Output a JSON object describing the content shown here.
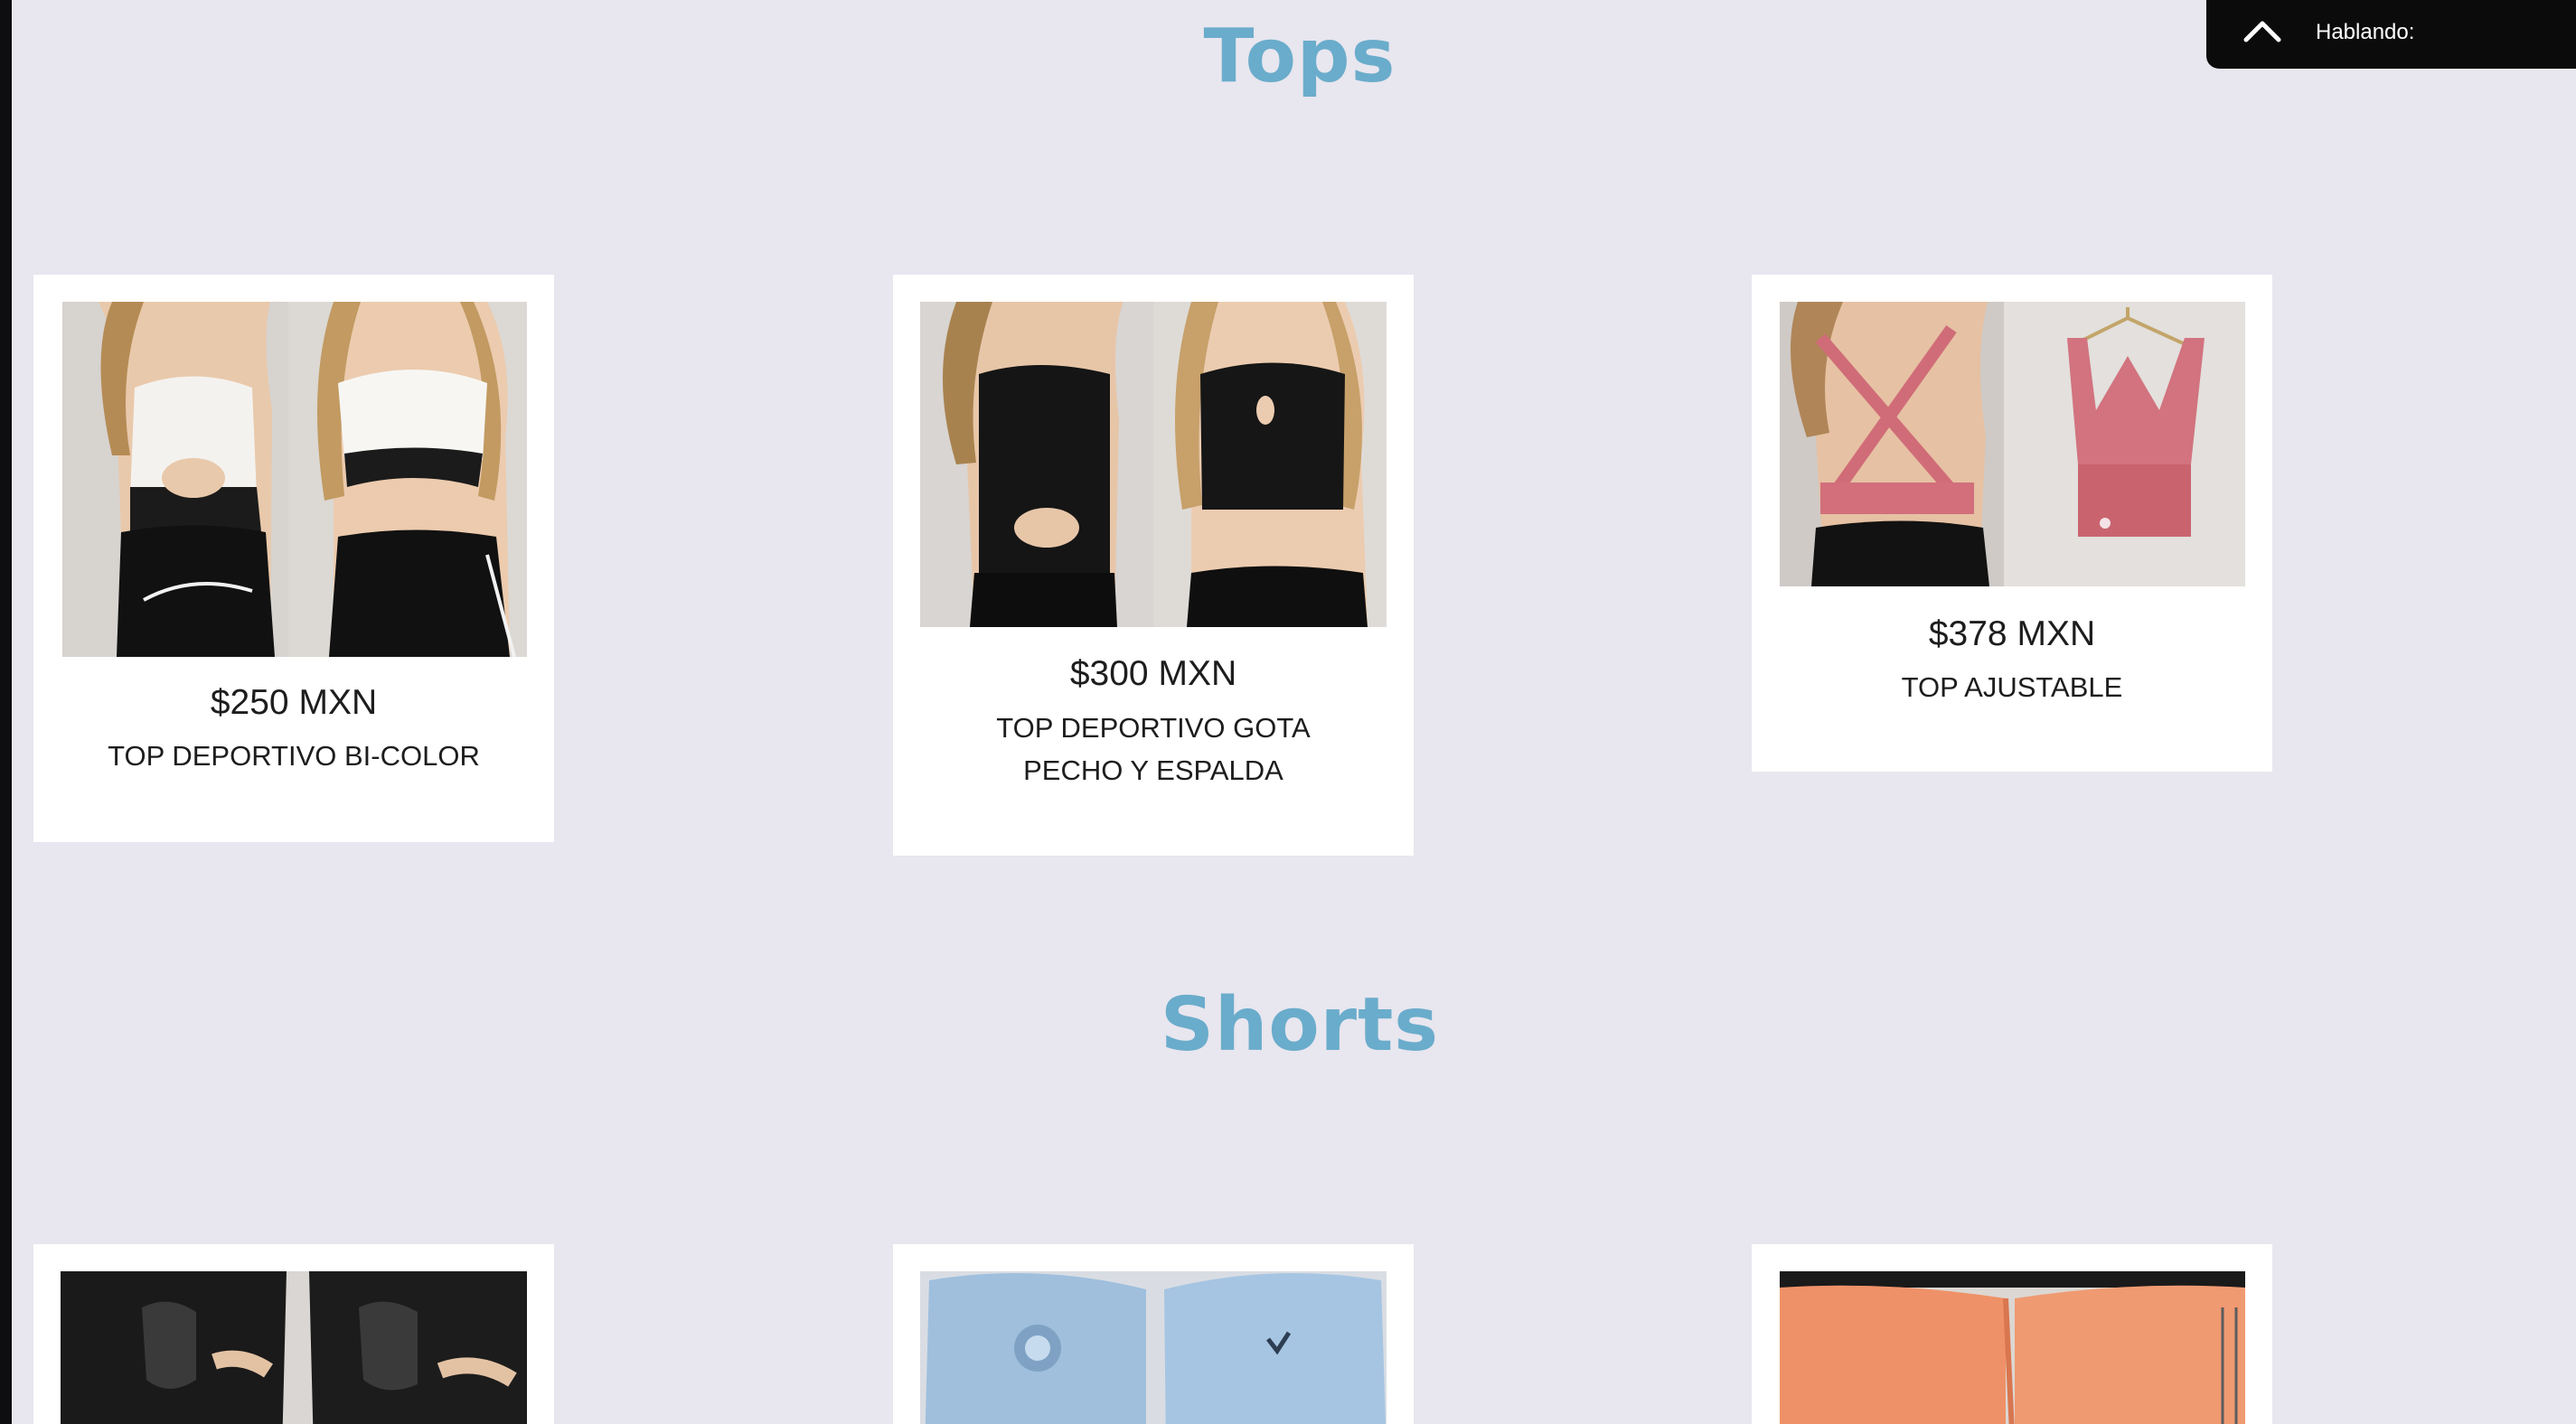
{
  "voice_widget": {
    "label": "Hablando:",
    "icon": "chevron-up-icon"
  },
  "sections": [
    {
      "title": "Tops",
      "products": [
        {
          "price": "$250 MXN",
          "name": "TOP DEPORTIVO BI-COLOR",
          "image": "woman-white-black-sports-top-photo"
        },
        {
          "price": "$300 MXN",
          "name": "TOP DEPORTIVO GOTA PECHO Y ESPALDA",
          "image": "woman-black-keyhole-sports-top-photo"
        },
        {
          "price": "$378 MXN",
          "name": "TOP AJUSTABLE",
          "image": "pink-crossback-sports-bra-photo"
        }
      ]
    },
    {
      "title": "Shorts",
      "products": [
        {
          "image": "black-mesh-shorts-photo"
        },
        {
          "image": "light-blue-denim-print-shorts-photo"
        },
        {
          "image": "orange-seamless-shorts-photo"
        }
      ]
    }
  ],
  "colors": {
    "background": "#e8e6ef",
    "section_title": "#6aaccb",
    "card": "#ffffff",
    "widget": "#0b0b0b"
  }
}
